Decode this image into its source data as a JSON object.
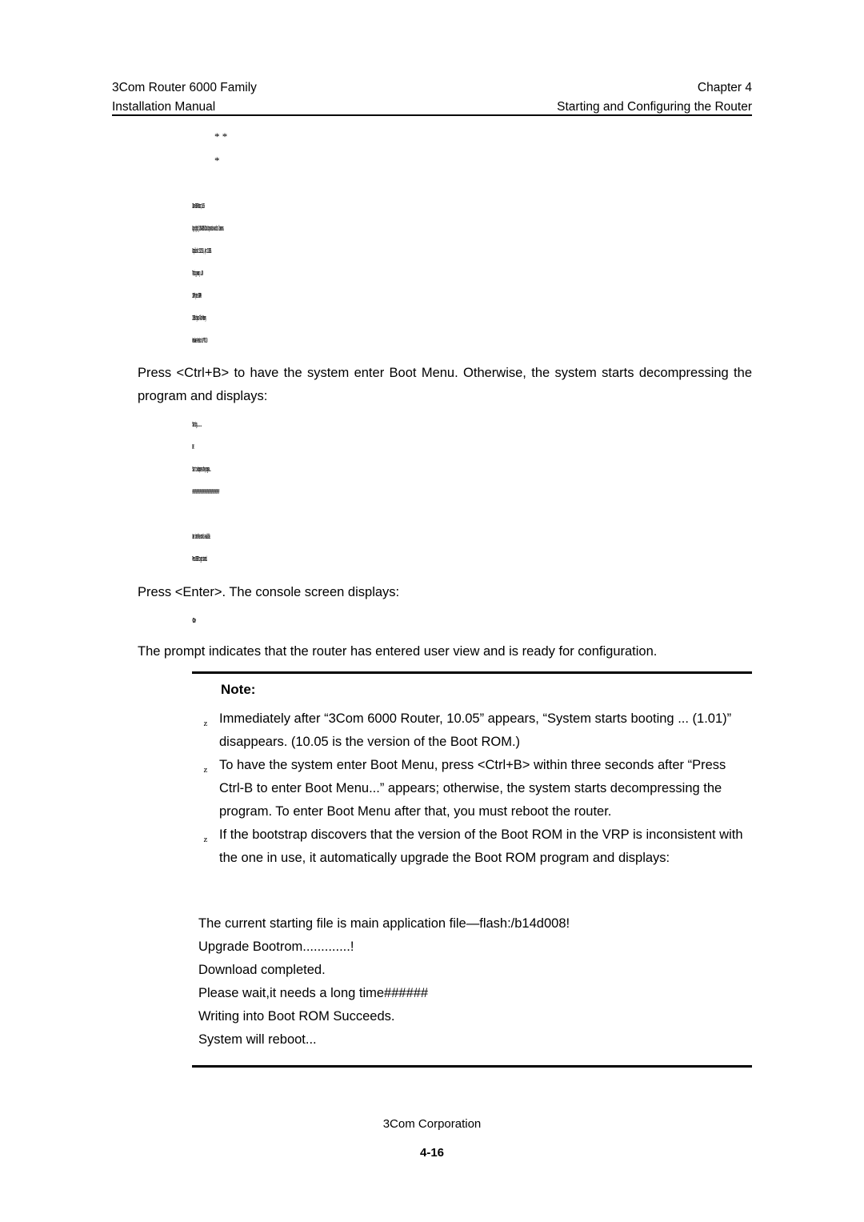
{
  "header": {
    "left_line1": "3Com Router 6000 Family",
    "left_line2": "Installation Manual",
    "right_line1": "Chapter  4",
    "right_line2": "Starting and Configuring the Router"
  },
  "console_top": {
    "stars_line1": "*                         *",
    "stars_line2": "*",
    "lines": [
      "3Com 6000 Router,10.05",
      "Copyright(c) 2004-2005 3Com Corporation and its licensors.",
      "Compiled at 15:21:50 , Apr 13 2005.",
      "Testing memory...OK!",
      "128M bytes SDRAM",
      "32768k bytes Flash Memory",
      "Hardware Version is MTR 2.0"
    ]
  },
  "paragraph_1": "Press <Ctrl+B> to have the system enter Boot Menu. Otherwise, the system starts decompressing the program and displays:",
  "console_mid": {
    "lines": [
      "Starting.........",
      "OK!",
      "Start to decompress the program...",
      "#################################################",
      "",
      "User interface con0 is available.",
      "Press ENTER to get started."
    ]
  },
  "paragraph_2": "Press <Enter>. The console screen displays:",
  "console_prompt": "<3Com>",
  "paragraph_3": "The prompt indicates that the router has entered user view and is ready for configuration.",
  "note": {
    "title": "Note:",
    "bullet_glyph": "z",
    "items": [
      "Immediately after “3Com 6000 Router, 10.05” appears, “System starts booting ... (1.01)” disappears. (10.05 is the version of the Boot ROM.)",
      "To have the system enter Boot Menu, press <Ctrl+B> within three seconds after “Press Ctrl-B to enter Boot Menu...” appears; otherwise, the system starts decompressing the program. To enter Boot Menu after that, you must reboot the router.",
      "If the bootstrap discovers that the version of the Boot ROM in the VRP is inconsistent with the one in use, it automatically upgrade the Boot ROM program and displays:"
    ],
    "plain_lines": [
      "The current starting file is main application file—flash:/b14d008!",
      "Upgrade Bootrom.............!",
      "Download completed.",
      "Please wait,it needs a long time######",
      "Writing into Boot ROM Succeeds.",
      "System will reboot..."
    ]
  },
  "footer": {
    "corporation": "3Com Corporation",
    "page_number": "4-16"
  }
}
